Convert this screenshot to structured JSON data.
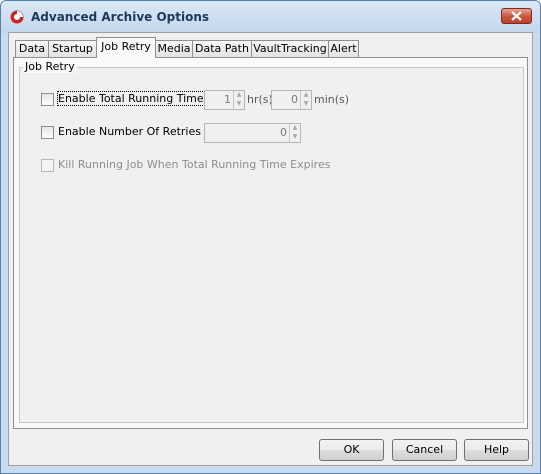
{
  "window": {
    "title": "Advanced Archive Options",
    "icon": "app-logo-icon",
    "close_icon": "close-icon"
  },
  "tabs": [
    {
      "label": "Data",
      "active": false
    },
    {
      "label": "Startup",
      "active": false
    },
    {
      "label": "Job Retry",
      "active": true
    },
    {
      "label": "Media",
      "active": false
    },
    {
      "label": "Data Path",
      "active": false
    },
    {
      "label": "VaultTracking",
      "active": false
    },
    {
      "label": "Alert",
      "active": false
    }
  ],
  "job_retry": {
    "group_label": "Job Retry",
    "total_running_time": {
      "label": "Enable Total Running Time",
      "checked": false,
      "hours_value": "1",
      "hours_unit": "hr(s)",
      "minutes_value": "0",
      "minutes_unit": "min(s)"
    },
    "number_of_retries": {
      "label": "Enable Number Of Retries",
      "checked": false,
      "value": "0"
    },
    "kill_running_job": {
      "label": "Kill Running Job When Total Running Time Expires",
      "checked": false,
      "enabled": false
    }
  },
  "buttons": {
    "ok": "OK",
    "cancel": "Cancel",
    "help": "Help"
  },
  "colors": {
    "title_text": "#1e395b",
    "close_button": "#c7543c",
    "frame": "#c9dbee"
  }
}
